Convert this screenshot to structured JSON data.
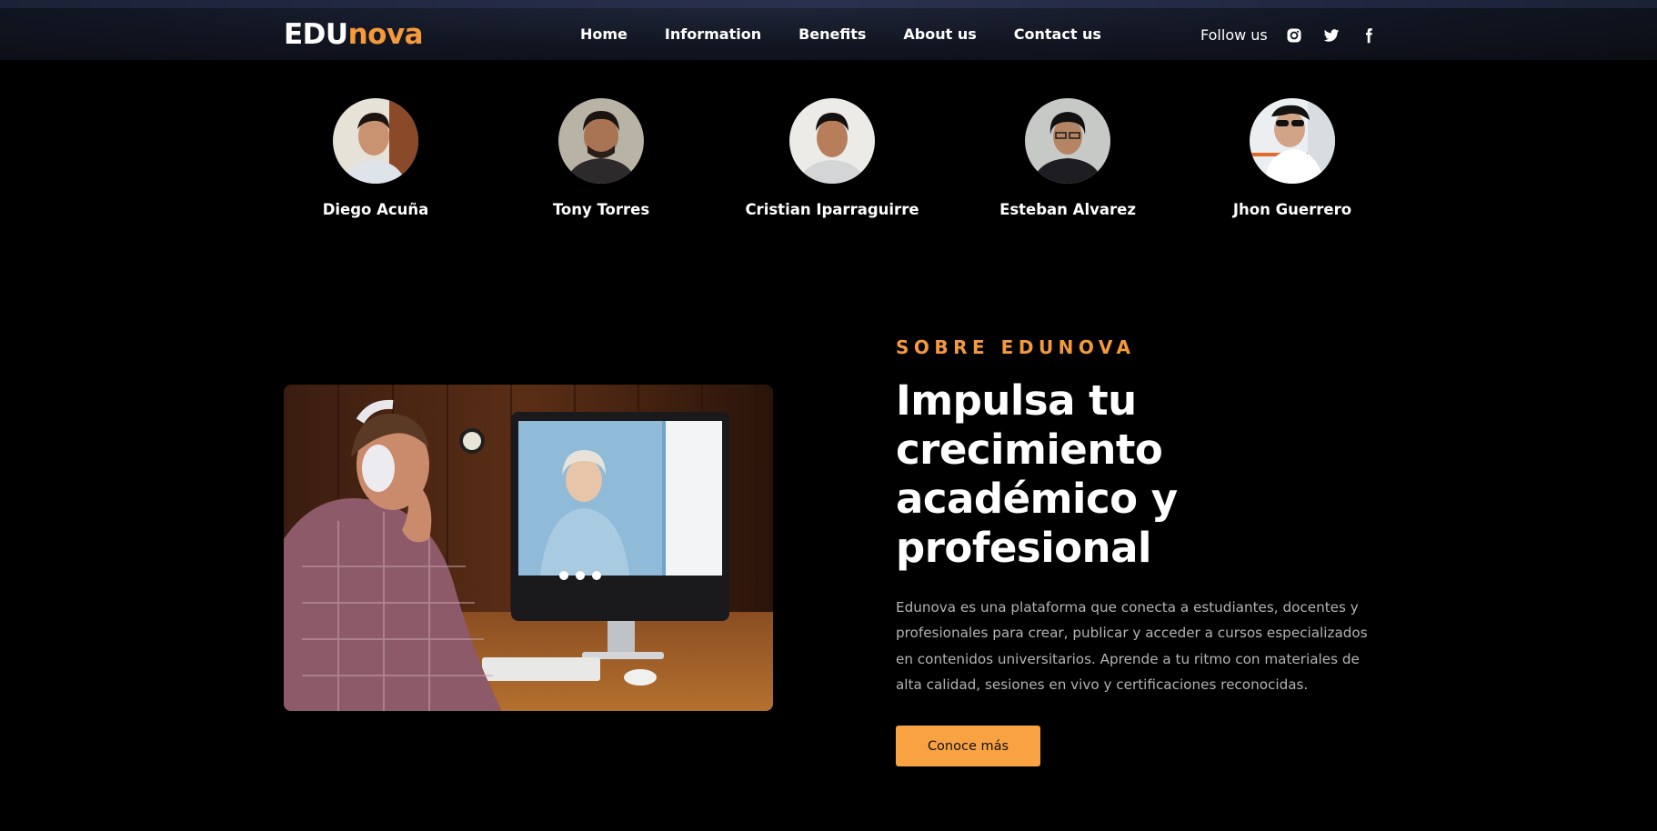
{
  "brand": {
    "logo_part1": "EDU",
    "logo_part2": "nova",
    "accent_color": "#f59a3c"
  },
  "nav": {
    "links": [
      {
        "label": "Home"
      },
      {
        "label": "Information"
      },
      {
        "label": "Benefits"
      },
      {
        "label": "About us"
      },
      {
        "label": "Contact us"
      }
    ],
    "follow_label": "Follow us",
    "social_icons": [
      "instagram-icon",
      "twitter-icon",
      "facebook-icon"
    ]
  },
  "team": {
    "members": [
      {
        "name": "Diego Acuña"
      },
      {
        "name": "Tony Torres"
      },
      {
        "name": "Cristian Iparraguirre"
      },
      {
        "name": "Esteban Alvarez"
      },
      {
        "name": "Jhon Guerrero"
      }
    ]
  },
  "about": {
    "eyebrow": "SOBRE EDUNOVA",
    "headline": "Impulsa tu crecimiento académico y profesional",
    "description": "Edunova es una plataforma que conecta a estudiantes, docentes y profesionales para crear, publicar y acceder a cursos especializados en contenidos universitarios. Aprende a tu ritmo con materiales de alta calidad, sesiones en vivo y certificaciones reconocidas.",
    "cta_label": "Conoce más",
    "cta_color": "#f9a241"
  }
}
